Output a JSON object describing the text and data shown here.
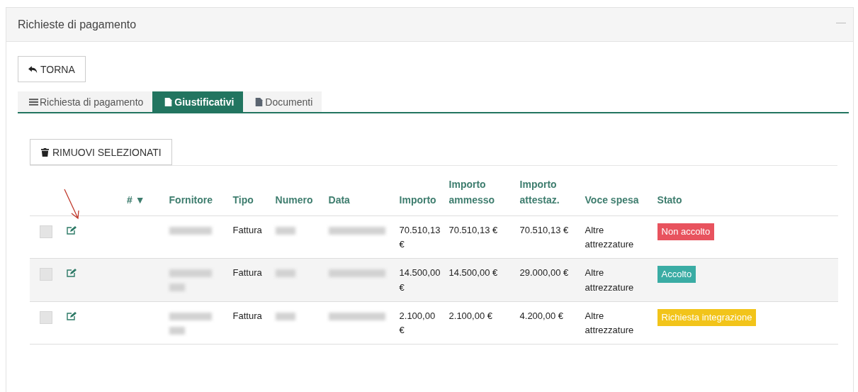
{
  "panel": {
    "title": "Richieste di pagamento",
    "collapse": "—"
  },
  "back_button": "TORNA",
  "tabs": [
    {
      "label": "Richiesta di pagamento",
      "selected": false
    },
    {
      "label": "Giustificativi",
      "selected": true
    },
    {
      "label": "Documenti",
      "selected": false
    }
  ],
  "remove_button": "RIMUOVI SELEZIONATI",
  "annotation": {
    "kind": "arrow"
  },
  "table": {
    "columns": [
      "",
      "",
      "# ▼",
      "Fornitore",
      "Tipo",
      "Numero",
      "Data",
      "Importo",
      "Importo ammesso",
      "Importo attestaz.",
      "Voce spesa",
      "Stato"
    ],
    "rows": [
      {
        "checked": false,
        "fornitore": {
          "kind": "blurred",
          "wrap": false
        },
        "tipo": "Fattura",
        "numero": {
          "kind": "blurred",
          "wrap": false
        },
        "data": {
          "kind": "blurred",
          "wrap": false
        },
        "importo": "70.510,13 €",
        "ammesso": "70.510,13 €",
        "attestaz": "70.510,13 €",
        "voce": "Altre attrezzature",
        "stato": {
          "label": "Non accolto",
          "color": "#e8535e"
        }
      },
      {
        "checked": false,
        "fornitore": {
          "kind": "blurred",
          "wrap": true
        },
        "tipo": "Fattura",
        "numero": {
          "kind": "blurred",
          "wrap": false
        },
        "data": {
          "kind": "blurred",
          "wrap": false
        },
        "importo": "14.500,00 €",
        "ammesso": "14.500,00 €",
        "attestaz": "29.000,00 €",
        "voce": "Altre attrezzature",
        "stato": {
          "label": "Accolto",
          "color": "#3aaca4"
        }
      },
      {
        "checked": false,
        "fornitore": {
          "kind": "blurred",
          "wrap": true
        },
        "tipo": "Fattura",
        "numero": {
          "kind": "blurred",
          "wrap": false
        },
        "data": {
          "kind": "blurred",
          "wrap": false
        },
        "importo": "2.100,00 €",
        "ammesso": "2.100,00 €",
        "attestaz": "4.200,00 €",
        "voce": "Altre attrezzature",
        "stato": {
          "label": "Richiesta integrazione",
          "color": "#f2c41a"
        }
      }
    ]
  }
}
